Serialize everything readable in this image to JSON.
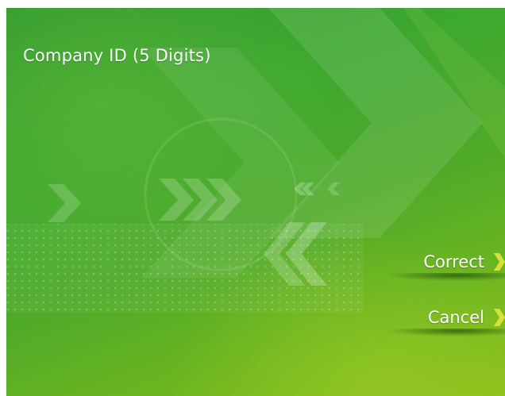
{
  "screen": {
    "title": "Company ID (5 Digits)"
  },
  "actions": [
    {
      "label": "Correct",
      "icon": "chevron-right-icon"
    },
    {
      "label": "Cancel",
      "icon": "chevron-right-icon"
    }
  ],
  "colors": {
    "background_dark": "#2f9a2e",
    "background_light": "#8dbf1c",
    "text": "#ffffff",
    "chevron_accent": "#d6e13a"
  }
}
